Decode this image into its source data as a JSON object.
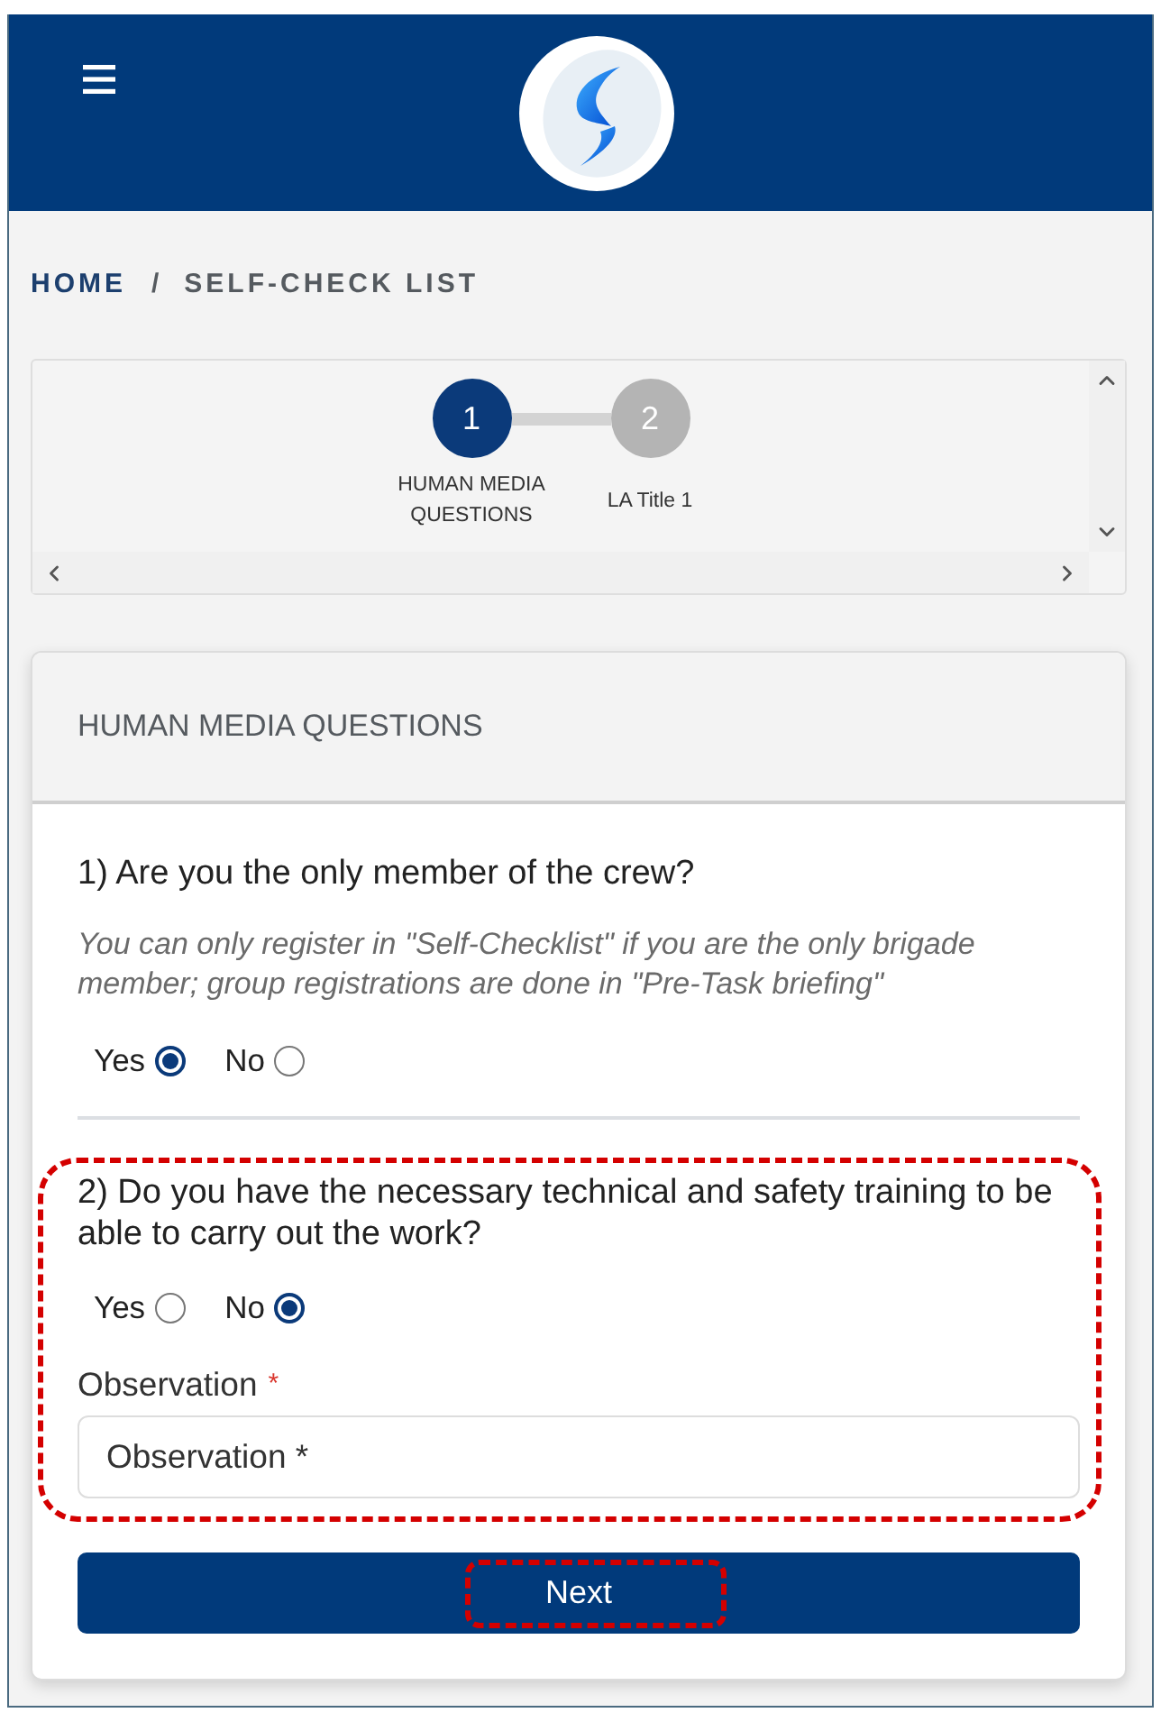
{
  "breadcrumb": {
    "items": [
      {
        "label": "HOME",
        "kind": "link"
      },
      {
        "label": "SELF-CHECK LIST",
        "kind": "current"
      }
    ],
    "separator": "/"
  },
  "stepper": {
    "steps": [
      {
        "number": "1",
        "label": "HUMAN MEDIA QUESTIONS",
        "selected": true
      },
      {
        "number": "2",
        "label": "LA Title 1",
        "selected": false
      }
    ]
  },
  "section": {
    "title": "HUMAN MEDIA QUESTIONS",
    "questions": [
      {
        "text": "1) Are you the only member of the crew?",
        "hint": "You can only register in \"Self-Checklist\" if you are the only brigade member; group registrations are done in \"Pre-Task briefing\"",
        "options": [
          {
            "label": "Yes",
            "selected": true
          },
          {
            "label": "No",
            "selected": false
          }
        ],
        "highlighted": false
      },
      {
        "text": "2) Do you have the necessary technical and safety training to be able to carry out the work?",
        "options": [
          {
            "label": "Yes",
            "selected": false
          },
          {
            "label": "No",
            "selected": true
          }
        ],
        "highlighted": true,
        "field": {
          "label": "Observation",
          "required_mark": "*",
          "placeholder": "Observation *"
        }
      }
    ]
  },
  "next_button": {
    "label": "Next",
    "highlighted": true
  }
}
